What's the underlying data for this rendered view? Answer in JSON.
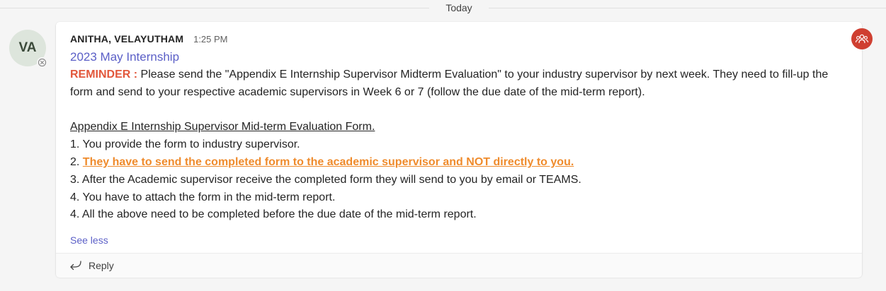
{
  "divider": {
    "label": "Today"
  },
  "message": {
    "avatar_initials": "VA",
    "author": "ANITHA, VELAYUTHAM",
    "time": "1:25 PM",
    "subject": "2023 May Internship",
    "reminder_label": "REMINDER :",
    "reminder_text": " Please send the \"Appendix E Internship Supervisor Midterm Evaluation\" to your industry supervisor by next week. They need to fill-up the form and send to your respective academic supervisors in Week 6 or 7 (follow the due date of the mid-term report).",
    "form_title": "Appendix E Internship Supervisor Mid-term Evaluation Form.",
    "steps": [
      {
        "prefix": "1. ",
        "text": "You provide the form to industry supervisor."
      },
      {
        "prefix": "2. ",
        "text": "They have to send the completed form to the academic supervisor and NOT directly to you."
      },
      {
        "prefix": "3. ",
        "text": "After the Academic supervisor receive the completed form they will send to you by email or TEAMS."
      },
      {
        "prefix": "4. ",
        "text": "You have to attach the form in the mid-term report."
      },
      {
        "prefix": "4. ",
        "text": "All the above need to be completed before the due date of the mid-term report."
      }
    ],
    "see_less": "See less",
    "reply_label": "Reply"
  },
  "icons": {
    "presence": "away-x-icon",
    "reply": "reply-arrow-icon",
    "team": "team-people-icon"
  },
  "colors": {
    "accent": "#5b5fc7",
    "reminder": "#e2573b",
    "highlight": "#ef8b2c",
    "team_badge": "#cf3f31"
  }
}
